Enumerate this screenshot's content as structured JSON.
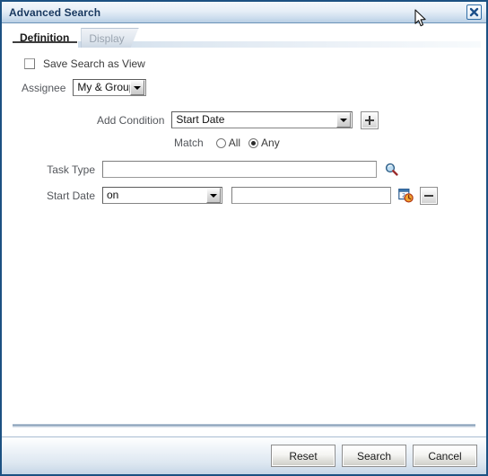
{
  "window": {
    "title": "Advanced Search",
    "close_icon": "close-icon"
  },
  "tabs": [
    {
      "label": "Definition",
      "active": true
    },
    {
      "label": "Display",
      "active": false
    }
  ],
  "form": {
    "save_search_checkbox": {
      "label": "Save Search as View",
      "checked": false
    },
    "assignee": {
      "label": "Assignee",
      "value": "My & Group"
    },
    "add_condition": {
      "label": "Add Condition",
      "value": "Start Date",
      "add_button_icon": "plus-icon"
    },
    "match": {
      "label": "Match",
      "options": [
        "All",
        "Any"
      ],
      "selected": "Any"
    },
    "task_type": {
      "label": "Task Type",
      "value": "",
      "placeholder": "",
      "search_icon": "search-icon"
    },
    "start_date": {
      "label": "Start Date",
      "operator": "on",
      "value": "",
      "placeholder": "",
      "calendar_icon": "calendar-clock-icon",
      "remove_button_icon": "minus-icon"
    }
  },
  "footer": {
    "reset_label": "Reset",
    "search_label": "Search",
    "cancel_label": "Cancel"
  },
  "colors": {
    "border": "#1c5182",
    "title_text": "#17375e",
    "label": "#54575c",
    "accent": "#2f6ca5"
  }
}
